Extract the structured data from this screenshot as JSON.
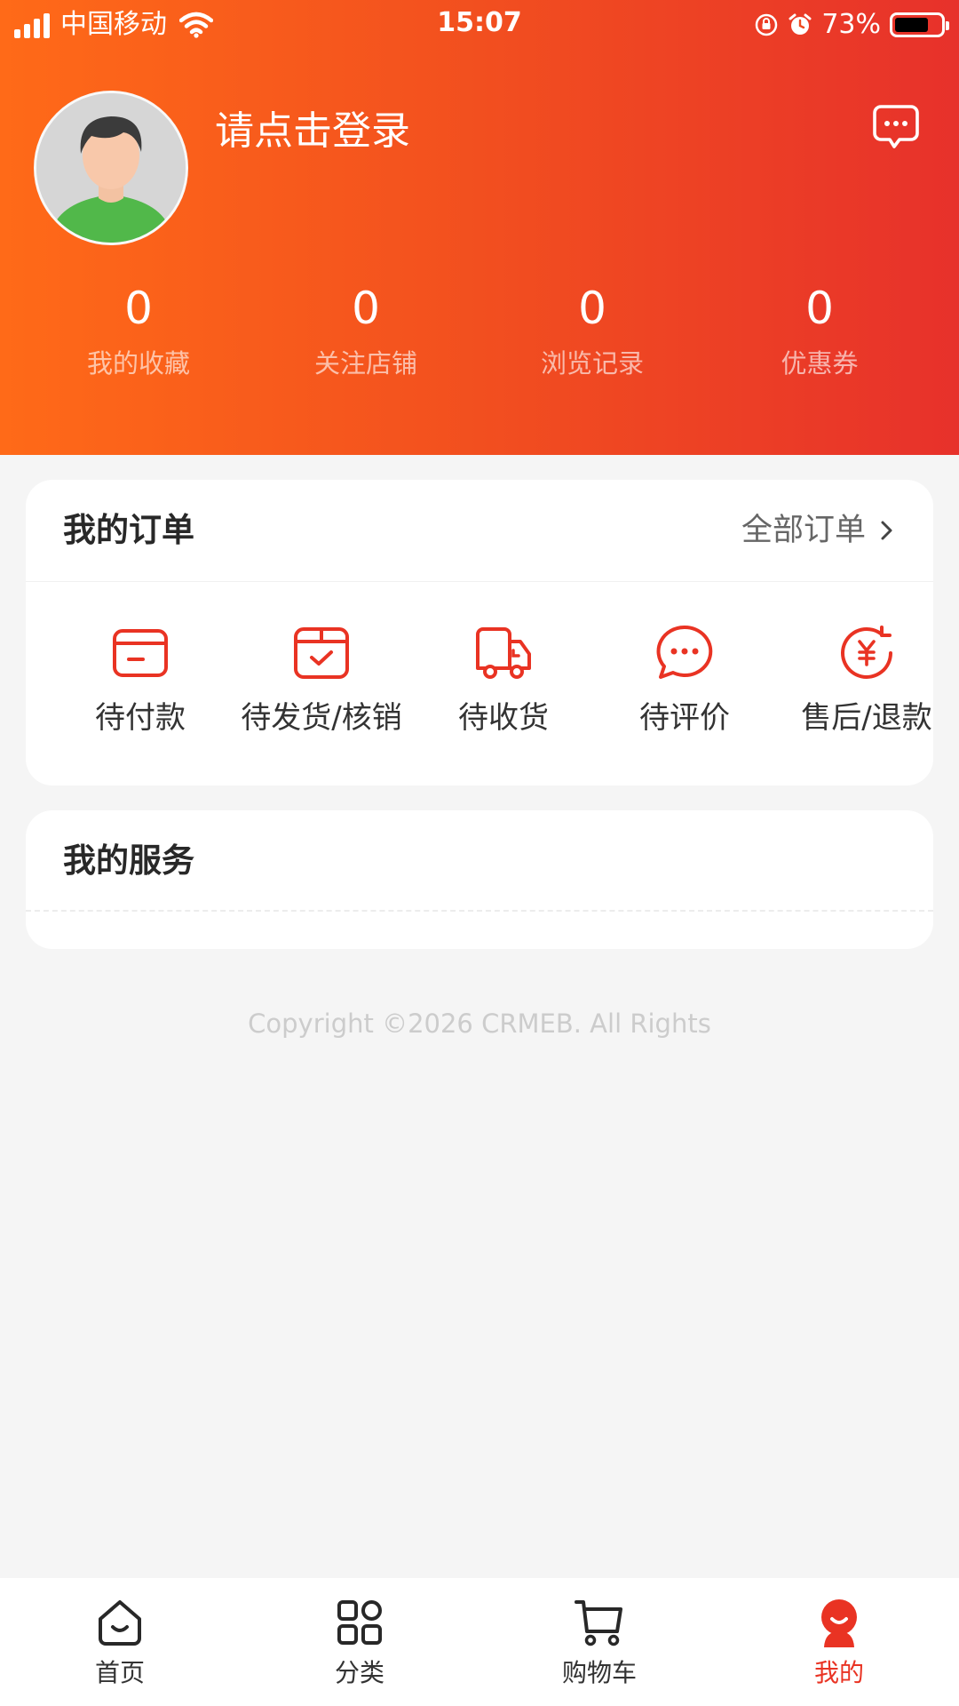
{
  "status_bar": {
    "carrier": "中国移动",
    "time": "15:07",
    "battery": "73%"
  },
  "header": {
    "login_text": "请点击登录",
    "stats": [
      {
        "value": "0",
        "label": "我的收藏"
      },
      {
        "value": "0",
        "label": "关注店铺"
      },
      {
        "value": "0",
        "label": "浏览记录"
      },
      {
        "value": "0",
        "label": "优惠券"
      }
    ]
  },
  "orders": {
    "title": "我的订单",
    "more_label": "全部订单",
    "items": [
      {
        "label": "待付款",
        "icon": "wallet-icon"
      },
      {
        "label": "待发货/核销",
        "icon": "package-check-icon"
      },
      {
        "label": "待收货",
        "icon": "truck-icon"
      },
      {
        "label": "待评价",
        "icon": "chat-bubble-icon"
      },
      {
        "label": "售后/退款",
        "icon": "yen-refund-icon"
      }
    ]
  },
  "services": {
    "title": "我的服务"
  },
  "copyright": "Copyright ©2026 CRMEB. All Rights",
  "tabbar": {
    "items": [
      {
        "label": "首页",
        "icon": "home-icon"
      },
      {
        "label": "分类",
        "icon": "category-grid-icon"
      },
      {
        "label": "购物车",
        "icon": "cart-icon"
      },
      {
        "label": "我的",
        "icon": "profile-icon"
      }
    ],
    "active_index": 3
  },
  "colors": {
    "header_start": "#ff6a18",
    "header_end": "#e7312b",
    "accent": "#e93323",
    "background": "#f5f5f5"
  }
}
